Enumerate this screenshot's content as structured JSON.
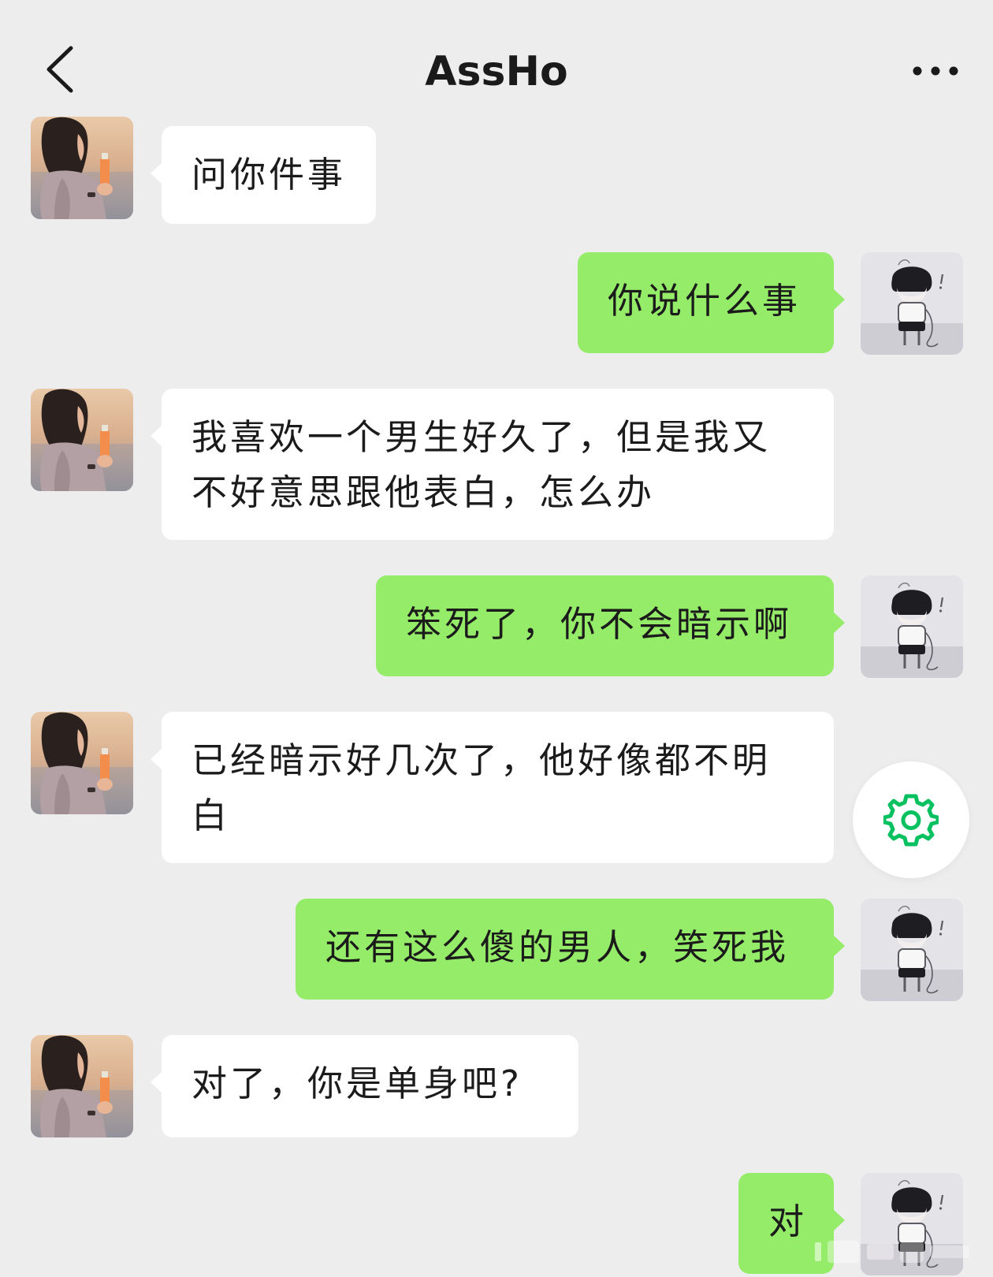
{
  "header": {
    "title": "AssHo",
    "back_icon": "chevron-left-icon",
    "more_icon": "more-horizontal-icon"
  },
  "messages": [
    {
      "side": "in",
      "text": "问你件事"
    },
    {
      "side": "out",
      "text": "你说什么事"
    },
    {
      "side": "in",
      "text": "我喜欢一个男生好久了，但是我又不好意思跟他表白，怎么办"
    },
    {
      "side": "out",
      "text": "笨死了，你不会暗示啊"
    },
    {
      "side": "in",
      "text": "已经暗示好几次了，他好像都不明白"
    },
    {
      "side": "out",
      "text": "还有这么傻的男人，笑死我"
    },
    {
      "side": "in",
      "text": "对了，你是单身吧?"
    },
    {
      "side": "out",
      "text": "对"
    }
  ],
  "floating_button": {
    "icon": "gear-icon"
  },
  "colors": {
    "background": "#ededed",
    "incoming_bubble": "#ffffff",
    "outgoing_bubble": "#95ec69",
    "accent": "#07c160"
  }
}
